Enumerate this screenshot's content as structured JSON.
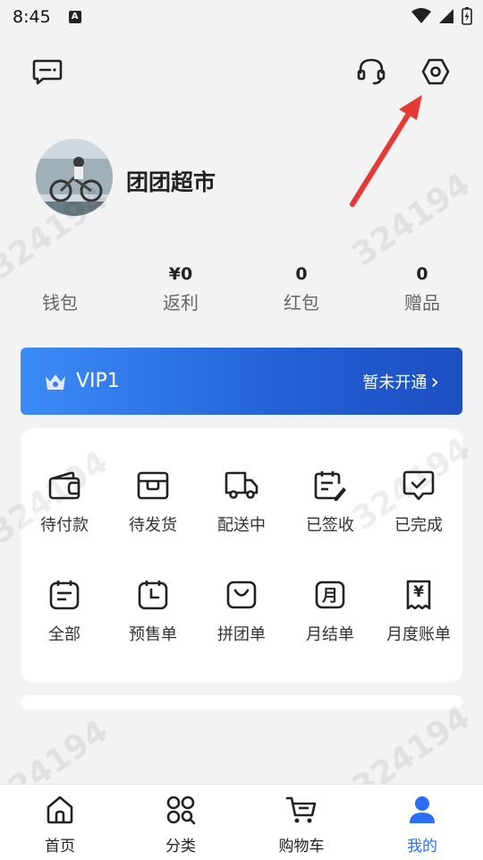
{
  "status_bar": {
    "time": "8:45",
    "notification_letter": "A"
  },
  "header": {
    "message_icon": "message-icon",
    "service_icon": "headset-icon",
    "settings_icon": "settings-hexagon-icon"
  },
  "profile": {
    "name": "团团超市"
  },
  "stats": [
    {
      "value": "",
      "label": "钱包"
    },
    {
      "value": "¥0",
      "label": "返利"
    },
    {
      "value": "0",
      "label": "红包"
    },
    {
      "value": "0",
      "label": "赠品"
    }
  ],
  "vip": {
    "level": "VIP1",
    "status": "暂未开通",
    "chevron": "›"
  },
  "orders": {
    "row1": [
      {
        "label": "待付款",
        "icon": "wallet-icon"
      },
      {
        "label": "待发货",
        "icon": "box-icon"
      },
      {
        "label": "配送中",
        "icon": "truck-icon"
      },
      {
        "label": "已签收",
        "icon": "sign-icon"
      },
      {
        "label": "已完成",
        "icon": "check-chat-icon"
      }
    ],
    "row2": [
      {
        "label": "全部",
        "icon": "list-icon"
      },
      {
        "label": "预售单",
        "icon": "clock-icon"
      },
      {
        "label": "拼团单",
        "icon": "group-bag-icon"
      },
      {
        "label": "月结单",
        "icon": "month-icon",
        "glyph": "月"
      },
      {
        "label": "月度账单",
        "icon": "bill-icon",
        "glyph": "¥"
      }
    ]
  },
  "watermark": "324194",
  "bottom_nav": [
    {
      "label": "首页",
      "icon": "home-icon",
      "active": false
    },
    {
      "label": "分类",
      "icon": "category-icon",
      "active": false
    },
    {
      "label": "购物车",
      "icon": "cart-icon",
      "active": false
    },
    {
      "label": "我的",
      "icon": "user-icon",
      "active": true
    }
  ],
  "colors": {
    "accent": "#2a6ff5",
    "vip_start": "#3b8cf7",
    "vip_end": "#1d4fc0",
    "annotation_arrow": "#e53935"
  }
}
